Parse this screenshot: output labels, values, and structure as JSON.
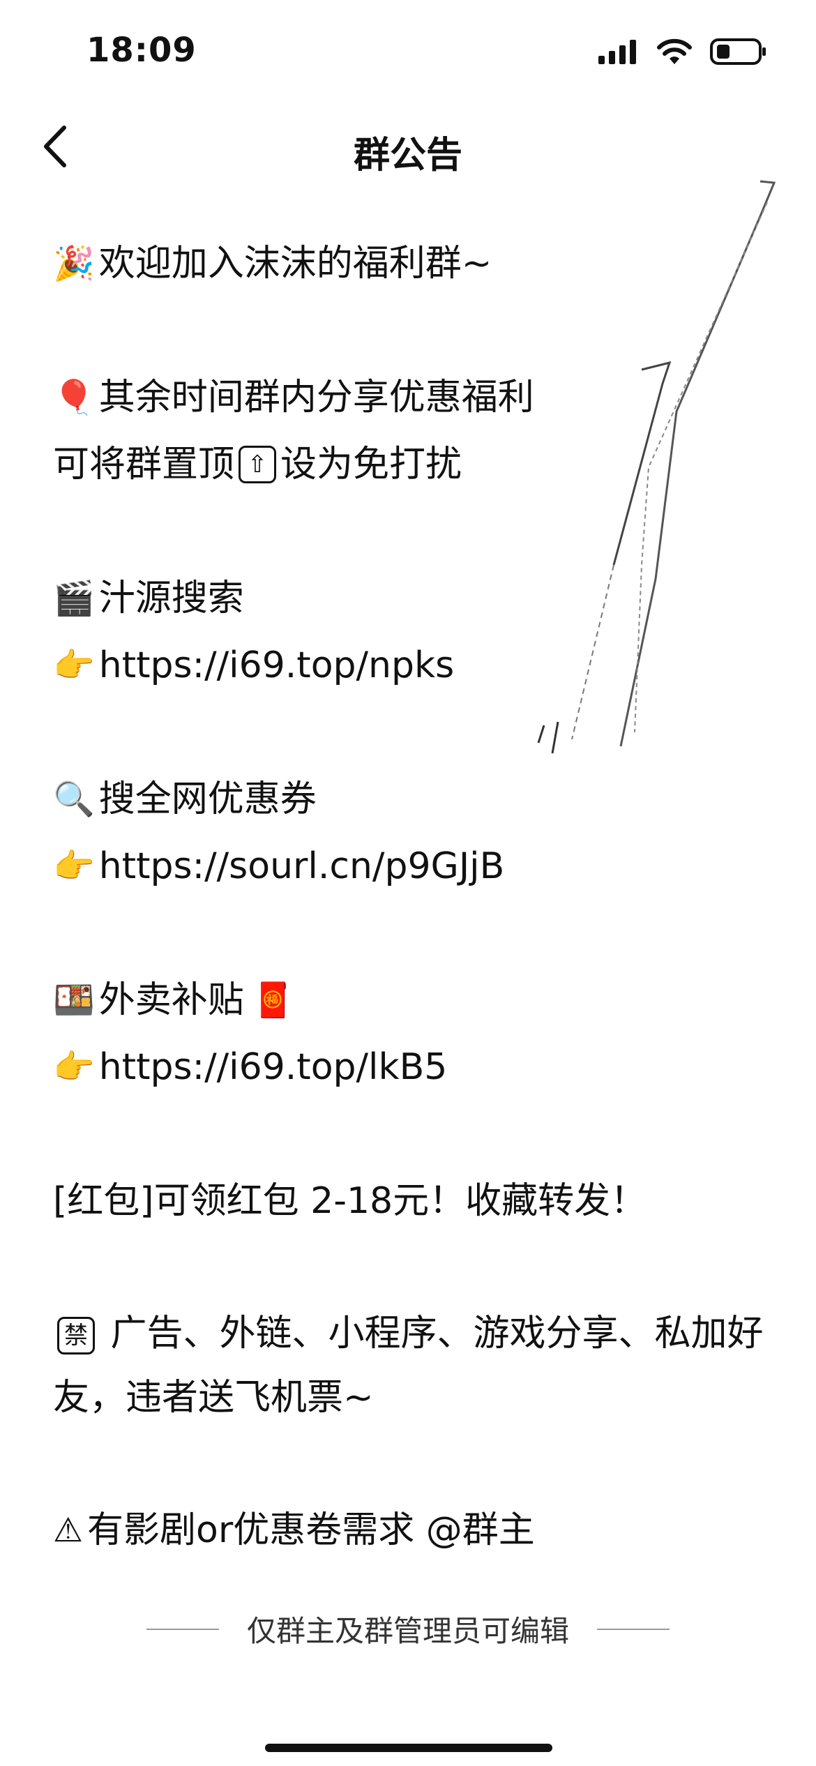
{
  "status_bar": {
    "time": "18:09"
  },
  "nav": {
    "title": "群公告"
  },
  "announcement": {
    "welcome": "欢迎加入沫沫的福利群~",
    "share_line": "其余时间群内分享优惠福利",
    "pin_line_a": "可将群置顶",
    "pin_line_b": "设为免打扰",
    "source_title": "汁源搜索",
    "source_link": "https://i69.top/npks",
    "coupon_title": "搜全网优惠券",
    "coupon_link": "https://sourl.cn/p9GJjB",
    "takeout_title": "外卖补贴",
    "takeout_link": "https://i69.top/lkB5",
    "redpack_line": "[红包]可领红包 2-18元！收藏转发！",
    "ban_line": "广告、外链、小程序、游戏分享、私加好友，违者送飞机票~",
    "request_line": "有影剧or优惠卷需求 @群主"
  },
  "footer": {
    "text": "仅群主及群管理员可编辑"
  }
}
